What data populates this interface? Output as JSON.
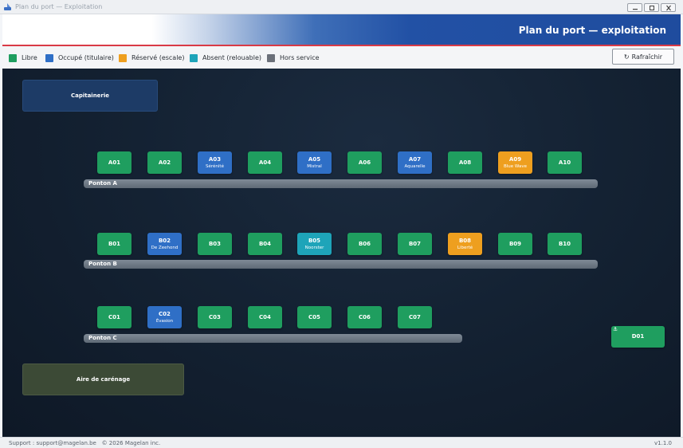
{
  "window": {
    "title": "Plan du port — Exploitation"
  },
  "banner": {
    "title": "Plan du port — exploitation"
  },
  "legend": [
    {
      "label": "Libre",
      "color": "#1f9e5f"
    },
    {
      "label": "Occupé (titulaire)",
      "color": "#2f6fc6"
    },
    {
      "label": "Réservé (escale)",
      "color": "#ee9f1f"
    },
    {
      "label": "Absent (relouable)",
      "color": "#1ea4b9"
    },
    {
      "label": "Hors service",
      "color": "#6b7079"
    }
  ],
  "toolbar": {
    "refresh_label": "Rafraîchir",
    "refresh_icon": "refresh-icon"
  },
  "zones": {
    "capitainerie": "Capitainerie",
    "careenage": "Aire de carénage"
  },
  "pontoons": {
    "A": "Ponton A",
    "B": "Ponton B",
    "C": "Ponton C"
  },
  "berths": {
    "A01": {
      "id": "A01",
      "status": "libre"
    },
    "A02": {
      "id": "A02",
      "status": "libre"
    },
    "A03": {
      "id": "A03",
      "status": "occupe",
      "boat": "Sérénité"
    },
    "A04": {
      "id": "A04",
      "status": "libre"
    },
    "A05": {
      "id": "A05",
      "status": "occupe",
      "boat": "Mistral"
    },
    "A06": {
      "id": "A06",
      "status": "libre"
    },
    "A07": {
      "id": "A07",
      "status": "occupe",
      "boat": "Aquarelle"
    },
    "A08": {
      "id": "A08",
      "status": "libre"
    },
    "A09": {
      "id": "A09",
      "status": "reserve",
      "boat": "Blue Wave"
    },
    "A10": {
      "id": "A10",
      "status": "libre"
    },
    "B01": {
      "id": "B01",
      "status": "libre"
    },
    "B02": {
      "id": "B02",
      "status": "occupe",
      "boat": "De Zeehond"
    },
    "B03": {
      "id": "B03",
      "status": "libre"
    },
    "B04": {
      "id": "B04",
      "status": "libre"
    },
    "B05": {
      "id": "B05",
      "status": "absent",
      "boat": "Noorster"
    },
    "B06": {
      "id": "B06",
      "status": "libre"
    },
    "B07": {
      "id": "B07",
      "status": "libre"
    },
    "B08": {
      "id": "B08",
      "status": "reserve",
      "boat": "Liberté"
    },
    "B09": {
      "id": "B09",
      "status": "libre"
    },
    "B10": {
      "id": "B10",
      "status": "libre"
    },
    "C01": {
      "id": "C01",
      "status": "libre"
    },
    "C02": {
      "id": "C02",
      "status": "occupe",
      "boat": "Évasion"
    },
    "C03": {
      "id": "C03",
      "status": "libre"
    },
    "C04": {
      "id": "C04",
      "status": "libre"
    },
    "C05": {
      "id": "C05",
      "status": "libre"
    },
    "C06": {
      "id": "C06",
      "status": "libre"
    },
    "C07": {
      "id": "C07",
      "status": "libre"
    },
    "D01": {
      "id": "D01",
      "status": "libre",
      "icon": "anchor-icon"
    }
  },
  "status": {
    "support": "Support : support@magelan.be",
    "copyright": "© 2026 Magelan inc.",
    "version": "v1.1.0"
  }
}
